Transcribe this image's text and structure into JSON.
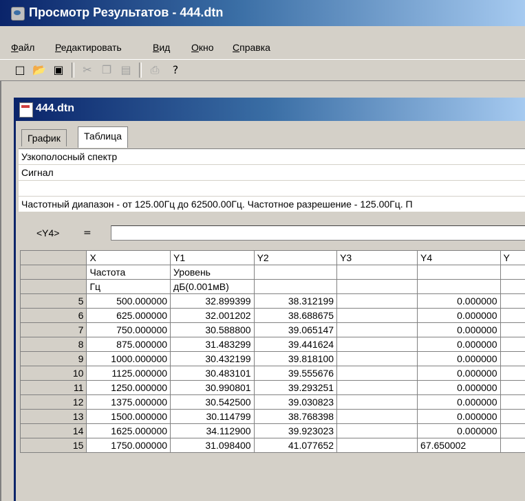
{
  "window": {
    "title": "Просмотр Результатов - 444.dtn"
  },
  "menu": [
    "Файл",
    "Редактировать",
    "Вид",
    "Окно",
    "Справка"
  ],
  "toolbar": {
    "icons": [
      "new-document-icon",
      "open-folder-icon",
      "save-icon",
      "cut-icon",
      "copy-icon",
      "paste-icon",
      "print-icon",
      "help-icon"
    ]
  },
  "child": {
    "title": "444.dtn"
  },
  "tabs": [
    "График",
    "Таблица"
  ],
  "info": {
    "line1": "Узкополосный спектр",
    "line2": "Сигнал",
    "line3": "",
    "line4": "Частотный диапазон - от 125.00Гц до 62500.00Гц.  Частотное разрешение - 125.00Гц.  П"
  },
  "formula": {
    "label": "<Y4>",
    "eq": "=",
    "value": ""
  },
  "columns": [
    "X",
    "Y1",
    "Y2",
    "Y3",
    "Y4",
    "Y"
  ],
  "names": [
    "Частота",
    "Уровень",
    "",
    "",
    "",
    ""
  ],
  "units": [
    "Гц",
    "дБ(0.001мВ)",
    "",
    "",
    "",
    ""
  ],
  "rows": [
    [
      "5",
      "500.000000",
      "32.899399",
      "38.312199",
      "",
      "0.000000"
    ],
    [
      "6",
      "625.000000",
      "32.001202",
      "38.688675",
      "",
      "0.000000"
    ],
    [
      "7",
      "750.000000",
      "30.588800",
      "39.065147",
      "",
      "0.000000"
    ],
    [
      "8",
      "875.000000",
      "31.483299",
      "39.441624",
      "",
      "0.000000"
    ],
    [
      "9",
      "1000.000000",
      "30.432199",
      "39.818100",
      "",
      "0.000000"
    ],
    [
      "10",
      "1125.000000",
      "30.483101",
      "39.555676",
      "",
      "0.000000"
    ],
    [
      "11",
      "1250.000000",
      "30.990801",
      "39.293251",
      "",
      "0.000000"
    ],
    [
      "12",
      "1375.000000",
      "30.542500",
      "39.030823",
      "",
      "0.000000"
    ],
    [
      "13",
      "1500.000000",
      "30.114799",
      "38.768398",
      "",
      "0.000000"
    ],
    [
      "14",
      "1625.000000",
      "34.112900",
      "39.923023",
      "",
      "0.000000"
    ],
    [
      "15",
      "1750.000000",
      "31.098400",
      "41.077652",
      "",
      "67.650002"
    ]
  ]
}
